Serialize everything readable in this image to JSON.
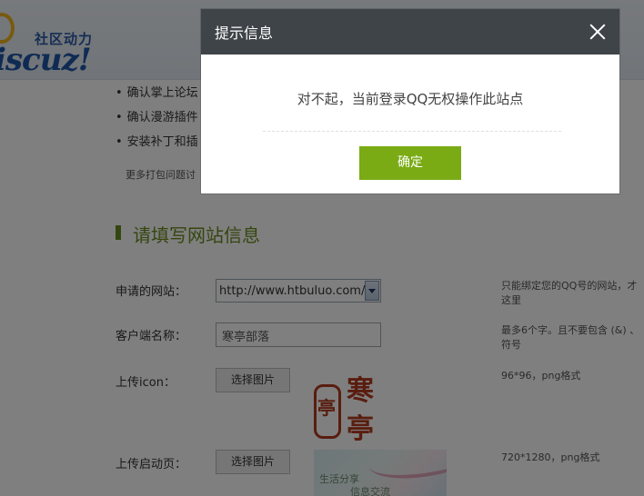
{
  "logo": {
    "cn": "社区动力",
    "en": "iscuz!"
  },
  "intro": {
    "bullets": [
      "确认掌上论坛",
      "确认漫游插件",
      "安装补丁和插"
    ],
    "more": "更多打包问题讨"
  },
  "section": {
    "title": "请填写网站信息"
  },
  "form": {
    "site": {
      "label": "申请的网站：",
      "value": "http://www.htbuluo.com/",
      "hint_line1": "只能绑定您的QQ号的网站，才",
      "hint_line2": "这里"
    },
    "client": {
      "label": "客户端名称：",
      "value": "寒亭部落",
      "hint_line1": "最多6个字。且不要包含 (&) 、",
      "hint_line2": "符号"
    },
    "icon": {
      "label": "上传icon：",
      "button": "选择图片",
      "hint": "96*96，png格式",
      "seal_left": "亭",
      "seal_right_top": "寒",
      "seal_right_bottom": "亭"
    },
    "splash": {
      "label": "上传启动页：",
      "button": "选择图片",
      "hint": "720*1280，png格式",
      "art_line1": "生活分享",
      "art_line2": "信息交流"
    }
  },
  "dialog": {
    "title": "提示信息",
    "message": "对不起，当前登录QQ无权操作此站点",
    "ok_label": "确定"
  },
  "colors": {
    "overlay": "rgba(0,0,0,0.5)",
    "dialog_header": "#3f4448",
    "ok_button": "#7aab14",
    "section_title": "#6a8c1f"
  }
}
